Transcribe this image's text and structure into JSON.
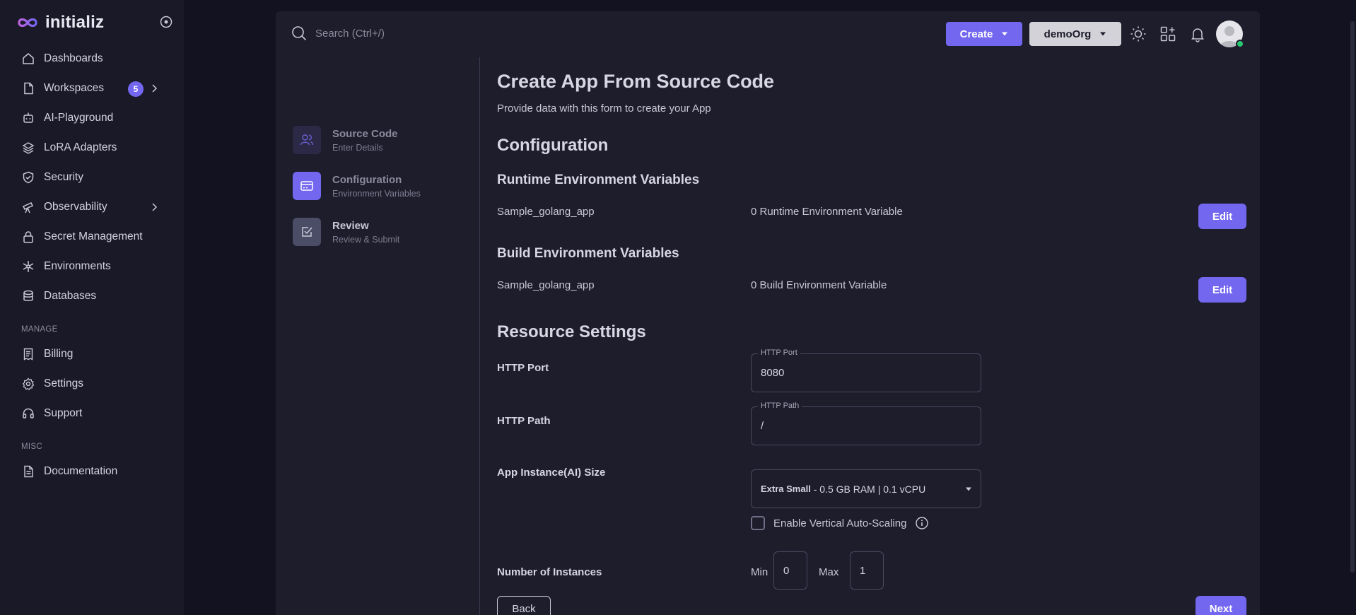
{
  "sidebar": {
    "brand": "initializ",
    "items": [
      {
        "label": "Dashboards",
        "icon": "home-icon"
      },
      {
        "label": "Workspaces",
        "icon": "file-icon",
        "badge": "5"
      },
      {
        "label": "AI-Playground",
        "icon": "robot-icon"
      },
      {
        "label": "LoRA Adapters",
        "icon": "layers-icon"
      },
      {
        "label": "Security",
        "icon": "shield-icon"
      },
      {
        "label": "Observability",
        "icon": "telescope-icon"
      },
      {
        "label": "Secret Management",
        "icon": "lock-icon"
      },
      {
        "label": "Environments",
        "icon": "snowflake-icon"
      },
      {
        "label": "Databases",
        "icon": "database-icon"
      }
    ],
    "manage_label": "MANAGE",
    "manage_items": [
      {
        "label": "Billing",
        "icon": "receipt-icon"
      },
      {
        "label": "Settings",
        "icon": "gear-icon"
      },
      {
        "label": "Support",
        "icon": "headset-icon"
      }
    ],
    "misc_label": "MISC",
    "misc_items": [
      {
        "label": "Documentation",
        "icon": "document-icon"
      }
    ]
  },
  "topbar": {
    "search_placeholder": "Search (Ctrl+/)",
    "create_label": "Create",
    "org_label": "demoOrg"
  },
  "stepper": [
    {
      "title": "Source Code",
      "subtitle": "Enter Details"
    },
    {
      "title": "Configuration",
      "subtitle": "Environment Variables"
    },
    {
      "title": "Review",
      "subtitle": "Review & Submit"
    }
  ],
  "form": {
    "title": "Create App From Source Code",
    "subtitle": "Provide data with this form to create your App",
    "configuration_heading": "Configuration",
    "runtime": {
      "heading": "Runtime Environment Variables",
      "app_name": "Sample_golang_app",
      "count_text": "0 Runtime Environment Variable",
      "edit_label": "Edit"
    },
    "build": {
      "heading": "Build Environment Variables",
      "app_name": "Sample_golang_app",
      "count_text": "0 Build Environment Variable",
      "edit_label": "Edit"
    },
    "resource_heading": "Resource Settings",
    "http_port": {
      "label": "HTTP Port",
      "legend": "HTTP Port",
      "value": "8080"
    },
    "http_path": {
      "label": "HTTP Path",
      "legend": "HTTP Path",
      "value": "/"
    },
    "instance_size": {
      "label": "App Instance(AI) Size",
      "selected_bold": "Extra Small",
      "selected_rest": " - 0.5 GB RAM | 0.1 vCPU"
    },
    "autoscaling_label": "Enable Vertical Auto-Scaling",
    "instances": {
      "label": "Number of Instances",
      "min_label": "Min",
      "min_value": "0",
      "max_label": "Max",
      "max_value": "1"
    },
    "back_label": "Back",
    "next_label": "Next"
  },
  "colors": {
    "accent": "#7367f0",
    "background": "#131220",
    "card": "#1e1d2c",
    "sidebar": "#1a1928"
  }
}
